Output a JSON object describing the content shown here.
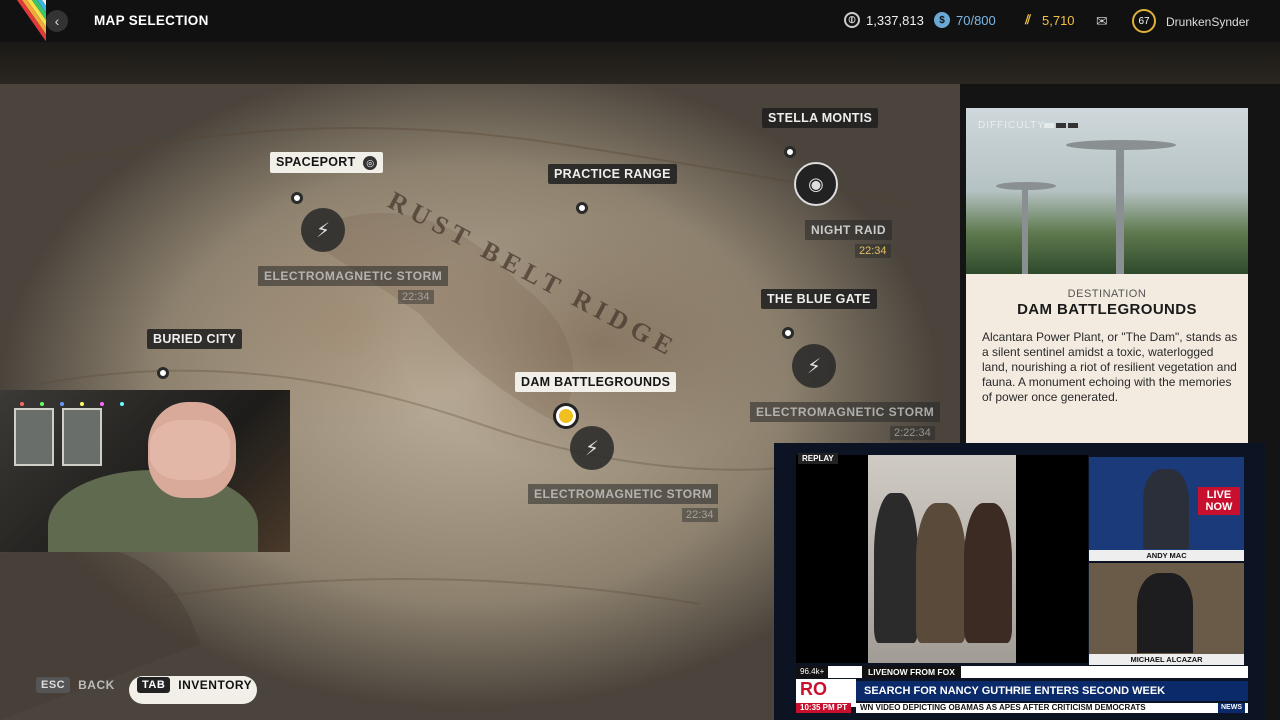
{
  "topbar": {
    "title": "MAP SELECTION",
    "currencies": [
      {
        "icon": "raider-coin-icon",
        "value": "1,337,813"
      },
      {
        "icon": "seed-icon",
        "value": "70/800"
      },
      {
        "icon": "cred-icon",
        "value": "5,710"
      }
    ],
    "level": "67",
    "username": "DrunkenSynder"
  },
  "map": {
    "regions": [
      "RUST BELT RIDGE"
    ],
    "pois": {
      "spaceport": "SPACEPORT",
      "practice_range": "PRACTICE RANGE",
      "stella_montis": "STELLA MONTIS",
      "night_raid": "NIGHT RAID",
      "blue_gate": "THE BLUE GATE",
      "buried_city": "BURIED CITY",
      "dam": "DAM BATTLEGROUNDS"
    },
    "storm_label": "ELECTROMAGNETIC STORM",
    "timers": {
      "spaceport": "22:34",
      "stella": "22:34",
      "blue_gate": "2:22:34",
      "dam": "22:34"
    }
  },
  "destination": {
    "difficulty_label": "DIFFICULTY",
    "difficulty_level": 2,
    "difficulty_max": 4,
    "kicker": "DESTINATION",
    "name": "DAM BATTLEGROUNDS",
    "description": "Alcantara Power Plant, or \"The Dam\", stands as a silent sentinel amidst a toxic, waterlogged land, nourishing a riot of resilient vegetation and fauna. A monument echoing with the memories of power once generated."
  },
  "hints": {
    "back_key": "ESC",
    "back_label": "BACK",
    "inv_key": "TAB",
    "inv_label": "INVENTORY"
  },
  "news": {
    "replay": "REPLAY",
    "anchor1": "ANDY MAC",
    "anchor2": "MICHAEL ALCAZAR",
    "live_badge": "LIVE NOW",
    "viewers": "96.4k+",
    "source": "LIVENOW FROM FOX",
    "headline": "SEARCH FOR NANCY GUTHRIE ENTERS SECOND WEEK",
    "time": "10:35 PM PT",
    "crawl": "WN VIDEO DEPICTING OBAMAS AS APES AFTER CRITICISM    DEMOCRATS",
    "logo": "RO",
    "news_tag": "NEWS"
  }
}
